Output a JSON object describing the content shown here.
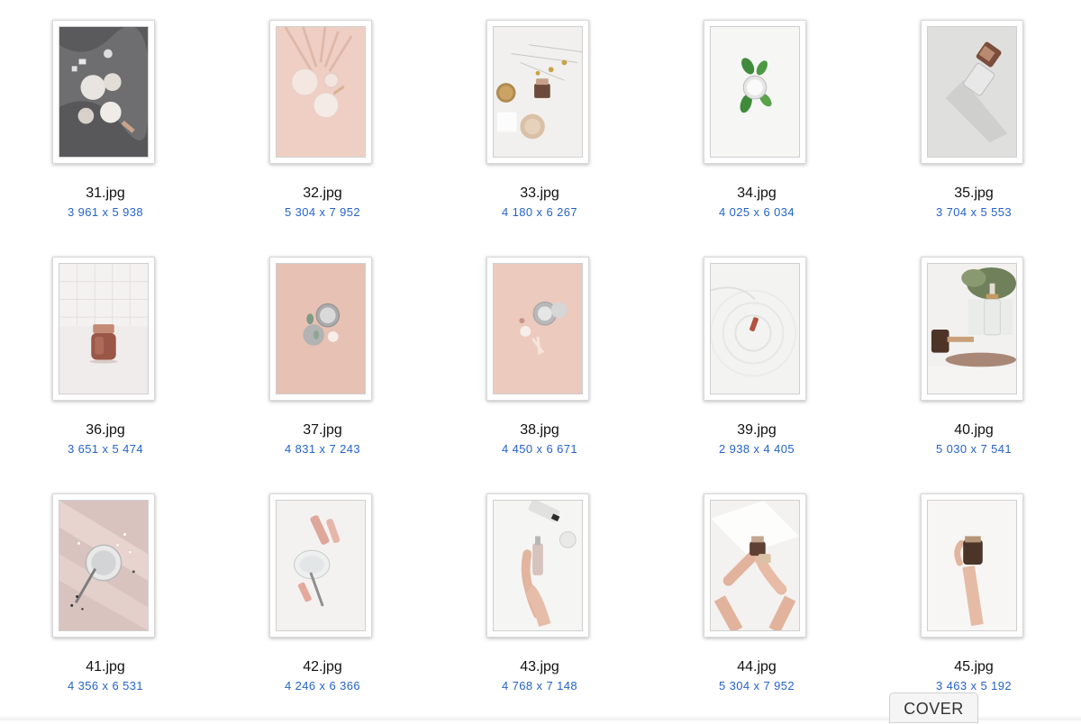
{
  "files": [
    {
      "name": "31.jpg",
      "dims": "3 961 x 5 938"
    },
    {
      "name": "32.jpg",
      "dims": "5 304 x 7 952"
    },
    {
      "name": "33.jpg",
      "dims": "4 180 x 6 267"
    },
    {
      "name": "34.jpg",
      "dims": "4 025 x 6 034"
    },
    {
      "name": "35.jpg",
      "dims": "3 704 x 5 553"
    },
    {
      "name": "36.jpg",
      "dims": "3 651 x 5 474"
    },
    {
      "name": "37.jpg",
      "dims": "4 831 x 7 243"
    },
    {
      "name": "38.jpg",
      "dims": "4 450 x 6 671"
    },
    {
      "name": "39.jpg",
      "dims": "2 938 x 4 405"
    },
    {
      "name": "40.jpg",
      "dims": "5 030 x 7 541"
    },
    {
      "name": "41.jpg",
      "dims": "4 356 x 6 531"
    },
    {
      "name": "42.jpg",
      "dims": "4 246 x 6 366"
    },
    {
      "name": "43.jpg",
      "dims": "4 768 x 7 148"
    },
    {
      "name": "44.jpg",
      "dims": "5 304 x 7 952"
    },
    {
      "name": "45.jpg",
      "dims": "3 463 x 5 192"
    }
  ],
  "cover_label": "COVER",
  "colors": {
    "dimension_text": "#2563c9",
    "filename_text": "#111111"
  }
}
